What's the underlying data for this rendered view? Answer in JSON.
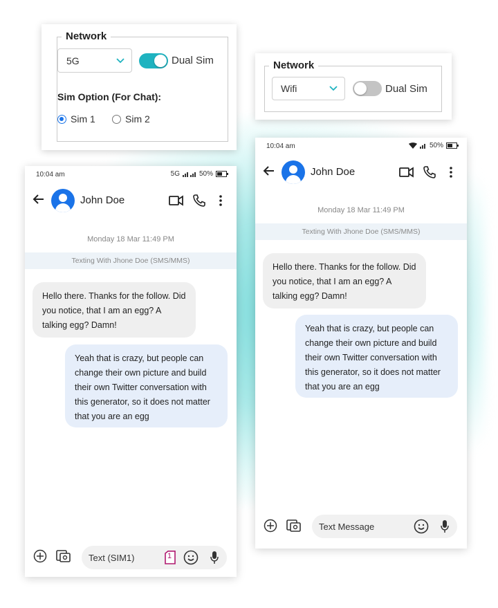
{
  "colors": {
    "accent": "#1a73e8",
    "toggle_on": "#1fb3c0",
    "toggle_off": "#c4c4c4",
    "sim_badge": "#b0186f",
    "bubble_in": "#efefef",
    "bubble_out": "#e6eefa"
  },
  "panel_left": {
    "legend": "Network",
    "select_value": "5G",
    "toggle_label": "Dual Sim",
    "toggle_on": true,
    "sim_option_title": "Sim Option (For Chat):",
    "radio_options": [
      {
        "label": "Sim 1",
        "selected": true
      },
      {
        "label": "Sim 2",
        "selected": false
      }
    ]
  },
  "panel_right": {
    "legend": "Network",
    "select_value": "Wifi",
    "toggle_label": "Dual Sim",
    "toggle_on": false
  },
  "phone_left": {
    "time": "10:04 am",
    "network": "5G",
    "battery": "50%",
    "contact_name": "John Doe",
    "date_label": "Monday 18 Mar 11:49 PM",
    "banner": "Texting With Jhone Doe (SMS/MMS)",
    "messages": [
      {
        "direction": "in",
        "text": "Hello there. Thanks for the follow. Did you notice, that I am an egg? A talking egg? Damn!"
      },
      {
        "direction": "out",
        "text": "Yeah that is crazy, but people can change their own picture and build their own Twitter conversation with this generator, so it does not matter that you are an egg"
      }
    ],
    "compose_placeholder": "Text (SIM1)",
    "sim_badge": "1",
    "icons": [
      "back-arrow-icon",
      "video-call-icon",
      "phone-icon",
      "more-vert-icon",
      "add-circle-icon",
      "gallery-icon",
      "emoji-icon",
      "mic-icon",
      "sim-card-icon"
    ]
  },
  "phone_right": {
    "time": "10:04 am",
    "battery": "50%",
    "contact_name": "John Doe",
    "date_label": "Monday 18 Mar 11:49 PM",
    "banner": "Texting With Jhone Doe (SMS/MMS)",
    "messages": [
      {
        "direction": "in",
        "text": "Hello there. Thanks for the follow. Did you notice, that I am an egg? A talking egg? Damn!"
      },
      {
        "direction": "out",
        "text": "Yeah that is crazy, but people can change their own picture and build their own Twitter conversation with this generator, so it does not matter that you are an egg"
      }
    ],
    "compose_placeholder": "Text Message",
    "icons": [
      "back-arrow-icon",
      "video-call-icon",
      "phone-icon",
      "more-vert-icon",
      "add-circle-icon",
      "gallery-icon",
      "emoji-icon",
      "mic-icon",
      "wifi-icon"
    ]
  }
}
